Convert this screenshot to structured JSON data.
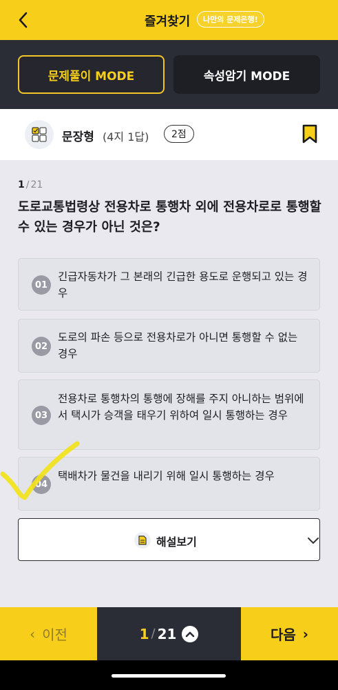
{
  "header": {
    "title": "즐겨찾기",
    "badge": "나만의 문제은행!"
  },
  "modes": {
    "solve": "문제풀이 MODE",
    "memorize": "속성암기 MODE",
    "active": "solve"
  },
  "question_type": {
    "name": "문장형",
    "detail": "(4지 1답)",
    "points": "2점"
  },
  "question": {
    "current": "1",
    "separator": "∕",
    "total": "21",
    "text": "도로교통법령상 전용차로 통행차 외에 전용차로로 통행할 수 있는 경우가 아닌 것은?"
  },
  "options": [
    {
      "num": "01",
      "text": "긴급자동차가 그 본래의 긴급한 용도로 운행되고 있는 경우"
    },
    {
      "num": "02",
      "text": "도로의 파손 등으로 전용차로가 아니면 통행할 수 없는 경우"
    },
    {
      "num": "03",
      "text": "전용차로 통행차의 통행에 장해를 주지 아니하는 범위에서 택시가 승객을 태우기 위하여 일시 통행하는 경우"
    },
    {
      "num": "04",
      "text": "택배차가 물건을 내리기 위해 일시 통행하는 경우"
    }
  ],
  "explanation": {
    "label": "해설보기"
  },
  "footer": {
    "prev_label": "이전",
    "next_label": "다음",
    "page_current": "1",
    "page_separator": "∕",
    "page_total": "21"
  },
  "colors": {
    "accent_yellow": "#f7cf1a",
    "dark_panel": "#2b2d36",
    "check_mark": "#f2e21a"
  }
}
